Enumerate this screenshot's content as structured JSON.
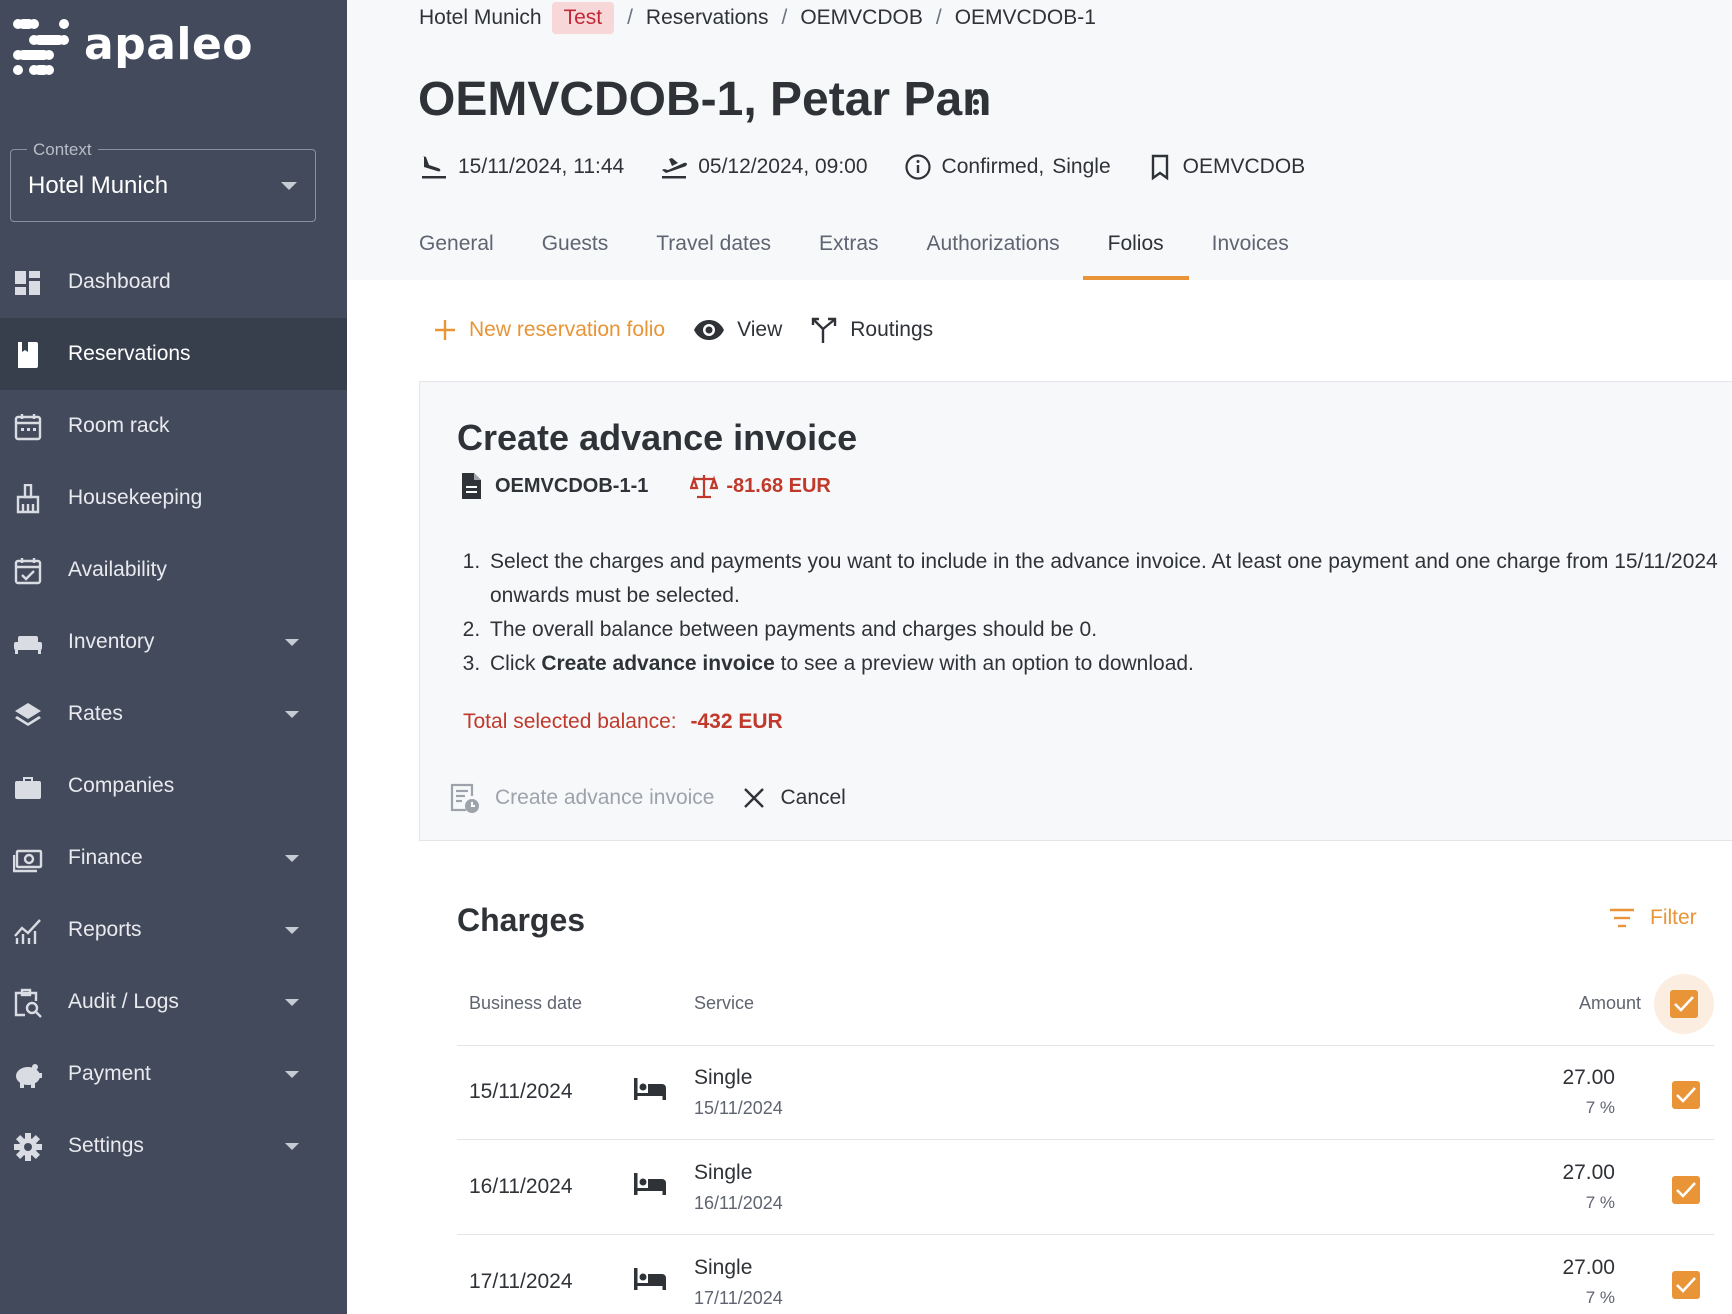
{
  "app": {
    "logo_text": "apaleo"
  },
  "sidebar": {
    "context_label": "Context",
    "context_value": "Hotel Munich",
    "items": [
      {
        "label": "Dashboard",
        "icon": "dashboard-icon",
        "has_caret": false
      },
      {
        "label": "Reservations",
        "icon": "reservations-icon",
        "has_caret": false,
        "active": true
      },
      {
        "label": "Room rack",
        "icon": "calendar-icon",
        "has_caret": false
      },
      {
        "label": "Housekeeping",
        "icon": "broom-icon",
        "has_caret": false
      },
      {
        "label": "Availability",
        "icon": "calendar-check-icon",
        "has_caret": false
      },
      {
        "label": "Inventory",
        "icon": "bed-icon",
        "has_caret": true
      },
      {
        "label": "Rates",
        "icon": "layers-icon",
        "has_caret": true
      },
      {
        "label": "Companies",
        "icon": "briefcase-icon",
        "has_caret": false
      },
      {
        "label": "Finance",
        "icon": "money-icon",
        "has_caret": true
      },
      {
        "label": "Reports",
        "icon": "chart-icon",
        "has_caret": true
      },
      {
        "label": "Audit / Logs",
        "icon": "audit-icon",
        "has_caret": true
      },
      {
        "label": "Payment",
        "icon": "piggy-bank-icon",
        "has_caret": true
      },
      {
        "label": "Settings",
        "icon": "gear-icon",
        "has_caret": true
      }
    ]
  },
  "breadcrumb": {
    "hotel": "Hotel Munich",
    "badge": "Test",
    "sep": "/",
    "reservations": "Reservations",
    "booking": "OEMVCDOB",
    "reservation": "OEMVCDOB-1"
  },
  "header": {
    "title": "OEMVCDOB-1, Petar Pan",
    "arrival": "15/11/2024, 11:44",
    "departure": "05/12/2024, 09:00",
    "status": "Confirmed,",
    "type": "Single",
    "booking_id": "OEMVCDOB"
  },
  "tabs": [
    "General",
    "Guests",
    "Travel dates",
    "Extras",
    "Authorizations",
    "Folios",
    "Invoices"
  ],
  "active_tab": "Folios",
  "toolbar": {
    "new_folio": "New reservation folio",
    "view": "View",
    "routings": "Routings"
  },
  "advance_invoice": {
    "title": "Create advance invoice",
    "folio_id": "OEMVCDOB-1-1",
    "folio_balance": "-81.68 EUR",
    "instruction_1": "Select the charges and payments you want to include in the advance invoice. At least one payment and one charge from 15/11/2024 onwards must be selected.",
    "instruction_2": "The overall balance between payments and charges should be 0.",
    "instruction_3_pre": "Click ",
    "instruction_3_bold": "Create advance invoice",
    "instruction_3_post": " to see a preview with an option to download.",
    "total_label": "Total selected balance:",
    "total_value": "-432 EUR",
    "create_button": "Create advance invoice",
    "cancel_button": "Cancel"
  },
  "charges": {
    "title": "Charges",
    "filter": "Filter",
    "columns": {
      "date": "Business date",
      "service": "Service",
      "amount": "Amount"
    },
    "select_all_checked": true,
    "rows": [
      {
        "date": "15/11/2024",
        "service": "Single",
        "service_date": "15/11/2024",
        "amount": "27.00",
        "vat": "7 %",
        "checked": true
      },
      {
        "date": "16/11/2024",
        "service": "Single",
        "service_date": "16/11/2024",
        "amount": "27.00",
        "vat": "7 %",
        "checked": true
      },
      {
        "date": "17/11/2024",
        "service": "Single",
        "service_date": "17/11/2024",
        "amount": "27.00",
        "vat": "7 %",
        "checked": true
      }
    ]
  },
  "colors": {
    "accent": "#e89437",
    "sidebar": "#424a5b",
    "negative": "#c0392b"
  }
}
